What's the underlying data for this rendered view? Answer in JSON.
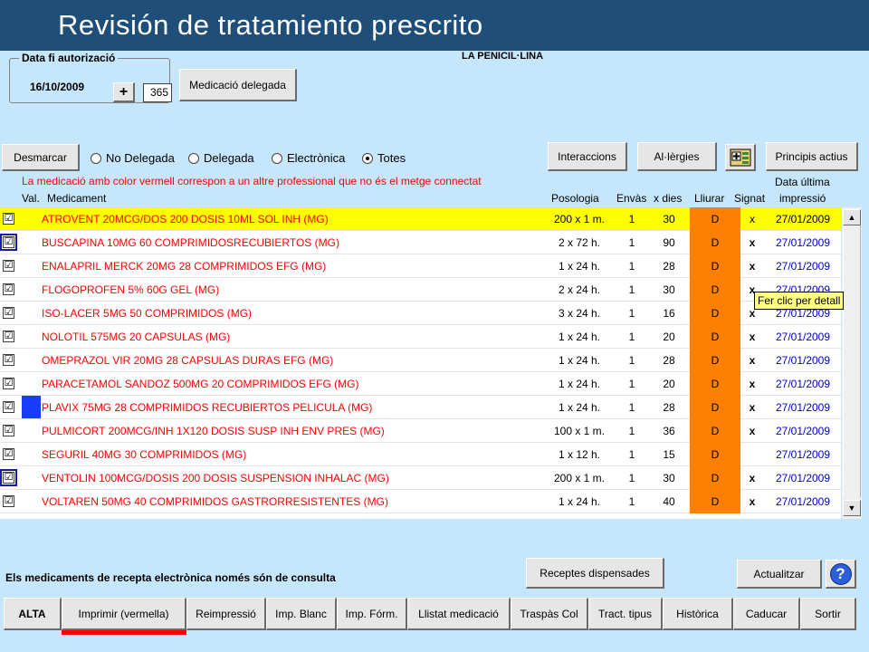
{
  "window": {
    "title": "Revisión de tratamiento prescrito"
  },
  "auth": {
    "legend": "Data fi autorizació",
    "date": "16/10/2009",
    "plus_label": "+",
    "days_value": "365",
    "delegated_button": "Medicació delegada"
  },
  "drug_header": "LA PENICIL·LINA",
  "toolbar": {
    "unmark": "Desmarcar",
    "interactions": "Interaccions",
    "allergies": "Al·lèrgies",
    "active_principles": "Principis actius"
  },
  "filters": {
    "options": [
      "No Delegada",
      "Delegada",
      "Electrònica",
      "Totes"
    ],
    "selected": "Totes"
  },
  "note": "La medicació amb color vermell correspon a un altre professional que no és el metge connectat",
  "columns": {
    "val": "Val.",
    "medicament": "Medicament",
    "posologia": "Posologia",
    "envasos": "Envàs",
    "dies": "x dies",
    "lliurar": "Lliurar",
    "signat": "Signat",
    "data_line1": "Data última",
    "data_line2": "impressió"
  },
  "rows": [
    {
      "checked": "☑",
      "name": "ATROVENT 20MCG/DOS 200 DOSIS 10ML SOL INH  (MG)",
      "posologia": "200 x 1 m.",
      "envasos": "1",
      "dies": "30",
      "lliurar": "D",
      "signat": "x",
      "date": "27/01/2009"
    },
    {
      "checked": "☑",
      "name": "BUSCAPINA 10MG 60 COMPRIMIDOSRECUBIERTOS  (MG)",
      "posologia": "2 x 72 h.",
      "envasos": "1",
      "dies": "90",
      "lliurar": "D",
      "signat": "x",
      "date": "27/01/2009"
    },
    {
      "checked": "☑",
      "name": "ENALAPRIL MERCK 20MG 28 COMPRIMIDOS EFG  (MG)",
      "posologia": "1 x 24 h.",
      "envasos": "1",
      "dies": "28",
      "lliurar": "D",
      "signat": "x",
      "date": "27/01/2009"
    },
    {
      "checked": "☑",
      "name": "FLOGOPROFEN 5% 60G GEL  (MG)",
      "posologia": "2 x 24 h.",
      "envasos": "1",
      "dies": "30",
      "lliurar": "D",
      "signat": "x",
      "date": "27/01/2009"
    },
    {
      "checked": "☑",
      "name": "ISO-LACER 5MG 50 COMPRIMIDOS  (MG)",
      "posologia": "3 x 24 h.",
      "envasos": "1",
      "dies": "16",
      "lliurar": "D",
      "signat": "x",
      "date": "27/01/2009"
    },
    {
      "checked": "☑",
      "name": "NOLOTIL 575MG 20 CAPSULAS  (MG)",
      "posologia": "1 x 24 h.",
      "envasos": "1",
      "dies": "20",
      "lliurar": "D",
      "signat": "x",
      "date": "27/01/2009"
    },
    {
      "checked": "☑",
      "name": "OMEPRAZOL VIR 20MG 28 CAPSULAS DURAS EFG  (MG)",
      "posologia": "1 x 24 h.",
      "envasos": "1",
      "dies": "28",
      "lliurar": "D",
      "signat": "x",
      "date": "27/01/2009"
    },
    {
      "checked": "☑",
      "name": "PARACETAMOL SANDOZ 500MG 20 COMPRIMIDOS EFG  (MG)",
      "posologia": "1 x 24 h.",
      "envasos": "1",
      "dies": "20",
      "lliurar": "D",
      "signat": "x",
      "date": "27/01/2009"
    },
    {
      "checked": "☑",
      "name": "PLAVIX 75MG 28 COMPRIMIDOS RECUBIERTOS PELICULA  (MG)",
      "posologia": "1 x 24 h.",
      "envasos": "1",
      "dies": "28",
      "lliurar": "D",
      "signat": "x",
      "date": "27/01/2009"
    },
    {
      "checked": "☑",
      "name": "PULMICORT 200MCG/INH 1X120 DOSIS SUSP INH ENV PRES  (MG)",
      "posologia": "100 x 1 m.",
      "envasos": "1",
      "dies": "36",
      "lliurar": "D",
      "signat": "x",
      "date": "27/01/2009"
    },
    {
      "checked": "☑",
      "name": "SEGURIL 40MG 30 COMPRIMIDOS  (MG)",
      "posologia": "1 x 12 h.",
      "envasos": "1",
      "dies": "15",
      "lliurar": "D",
      "signat": "",
      "date": "27/01/2009"
    },
    {
      "checked": "☑",
      "name": "VENTOLIN 100MCG/DOSIS 200 DOSIS SUSPENSION INHALAC  (MG)",
      "posologia": "200 x 1 m.",
      "envasos": "1",
      "dies": "30",
      "lliurar": "D",
      "signat": "x",
      "date": "27/01/2009"
    },
    {
      "checked": "☑",
      "name": "VOLTAREN 50MG 40 COMPRIMIDOS GASTRORRESISTENTES  (MG)",
      "posologia": "1 x 24 h.",
      "envasos": "1",
      "dies": "40",
      "lliurar": "D",
      "signat": "x",
      "date": "27/01/2009"
    }
  ],
  "tooltip": "Fer clic per detall",
  "footer_note": "Els medicaments de recepta electrònica només són de consulta",
  "buttons": {
    "dispensed": "Receptes dispensades",
    "update": "Actualitzar",
    "help": "?"
  },
  "bottom_bar": [
    "ALTA",
    "Imprimir (vermella)",
    "Reimpressió",
    "Imp. Blanc",
    "Imp. Fórm.",
    "Llistat medicació",
    "Traspàs Col",
    "Tract. tipus",
    "Històrica",
    "Caducar",
    "Sortir"
  ],
  "colors": {
    "title_bar": "#1f4e79",
    "app_bg": "#c6e6fb",
    "row_highlight": "#ffff00",
    "lliurar_bg": "#ff7f00",
    "date_text": "#0000cc"
  }
}
